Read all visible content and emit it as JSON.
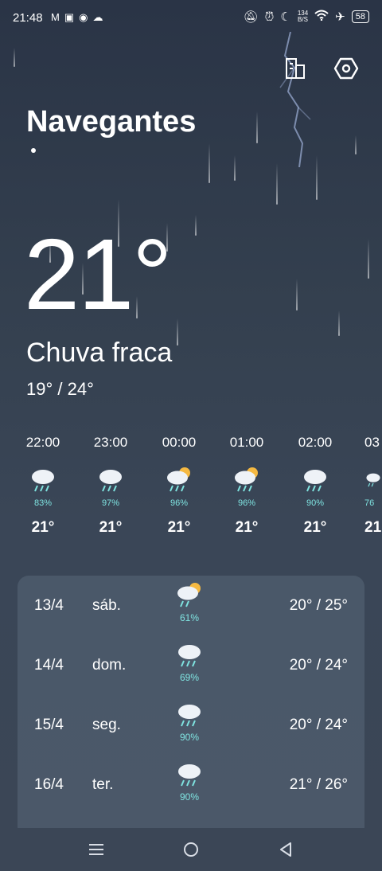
{
  "status_bar": {
    "time": "21:48",
    "network_speed_value": "134",
    "network_speed_unit": "B/S",
    "battery": "58"
  },
  "header": {
    "city": "Navegantes"
  },
  "current": {
    "temperature": "21°",
    "condition": "Chuva fraca",
    "range": "19° / 24°"
  },
  "hourly": [
    {
      "hour": "22:00",
      "icon": "rain-cloud-icon",
      "precip": "83%",
      "temp": "21°"
    },
    {
      "hour": "23:00",
      "icon": "rain-cloud-icon",
      "precip": "97%",
      "temp": "21°"
    },
    {
      "hour": "00:00",
      "icon": "sun-rain-cloud-icon",
      "precip": "96%",
      "temp": "21°"
    },
    {
      "hour": "01:00",
      "icon": "sun-rain-cloud-icon",
      "precip": "96%",
      "temp": "21°"
    },
    {
      "hour": "02:00",
      "icon": "rain-cloud-icon",
      "precip": "90%",
      "temp": "21°"
    },
    {
      "hour": "03",
      "icon": "rain-cloud-icon",
      "precip": "76",
      "temp": "21"
    }
  ],
  "daily": [
    {
      "date": "13/4",
      "weekday": "sáb.",
      "icon": "sun-rain-cloud-icon",
      "precip": "61%",
      "range": "20° / 25°"
    },
    {
      "date": "14/4",
      "weekday": "dom.",
      "icon": "rain-cloud-icon",
      "precip": "69%",
      "range": "20° / 24°"
    },
    {
      "date": "15/4",
      "weekday": "seg.",
      "icon": "rain-cloud-icon",
      "precip": "90%",
      "range": "20° / 24°"
    },
    {
      "date": "16/4",
      "weekday": "ter.",
      "icon": "rain-cloud-icon",
      "precip": "90%",
      "range": "21° / 26°"
    }
  ],
  "colors": {
    "precip_text": "#7fe3e0",
    "background": "#34404f"
  }
}
